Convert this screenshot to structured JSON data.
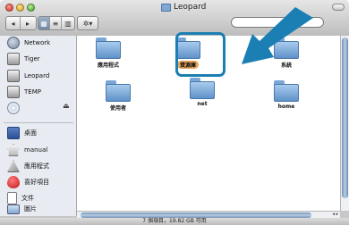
{
  "window": {
    "title": "Leopard"
  },
  "toolbar": {
    "back_icon": "back-arrow-icon",
    "forward_icon": "forward-arrow-icon",
    "view_icons": [
      "icon-view-icon",
      "list-view-icon",
      "column-view-icon"
    ],
    "action_label": "✲▾",
    "search_placeholder": ""
  },
  "sidebar": {
    "items": [
      {
        "label": "Network",
        "icon": "network-globe-icon"
      },
      {
        "label": "Tiger",
        "icon": "hard-drive-icon"
      },
      {
        "label": "Leopard",
        "icon": "hard-drive-icon"
      },
      {
        "label": "TEMP",
        "icon": "hard-drive-icon"
      },
      {
        "label": "",
        "icon": "cd-disc-icon"
      }
    ],
    "places": [
      {
        "label": "桌面",
        "icon": "desktop-icon"
      },
      {
        "label": "manual",
        "icon": "home-icon"
      },
      {
        "label": "應用程式",
        "icon": "applications-icon"
      },
      {
        "label": "喜好項目",
        "icon": "favorites-heart-icon"
      },
      {
        "label": "文件",
        "icon": "documents-icon"
      },
      {
        "label": "圖片",
        "icon": "pictures-icon"
      }
    ]
  },
  "files": [
    {
      "label": "應用程式"
    },
    {
      "label": "資源庫",
      "selected": true
    },
    {
      "label": "系統"
    },
    {
      "label": "使用者"
    },
    {
      "label": "net"
    },
    {
      "label": "home"
    }
  ],
  "status": {
    "text": "7 個項目，19.82 GB 可用"
  },
  "colors": {
    "accent_arrow": "#1b7fb3",
    "selection": "#e7a45b",
    "folder": "#6a9bd0"
  }
}
